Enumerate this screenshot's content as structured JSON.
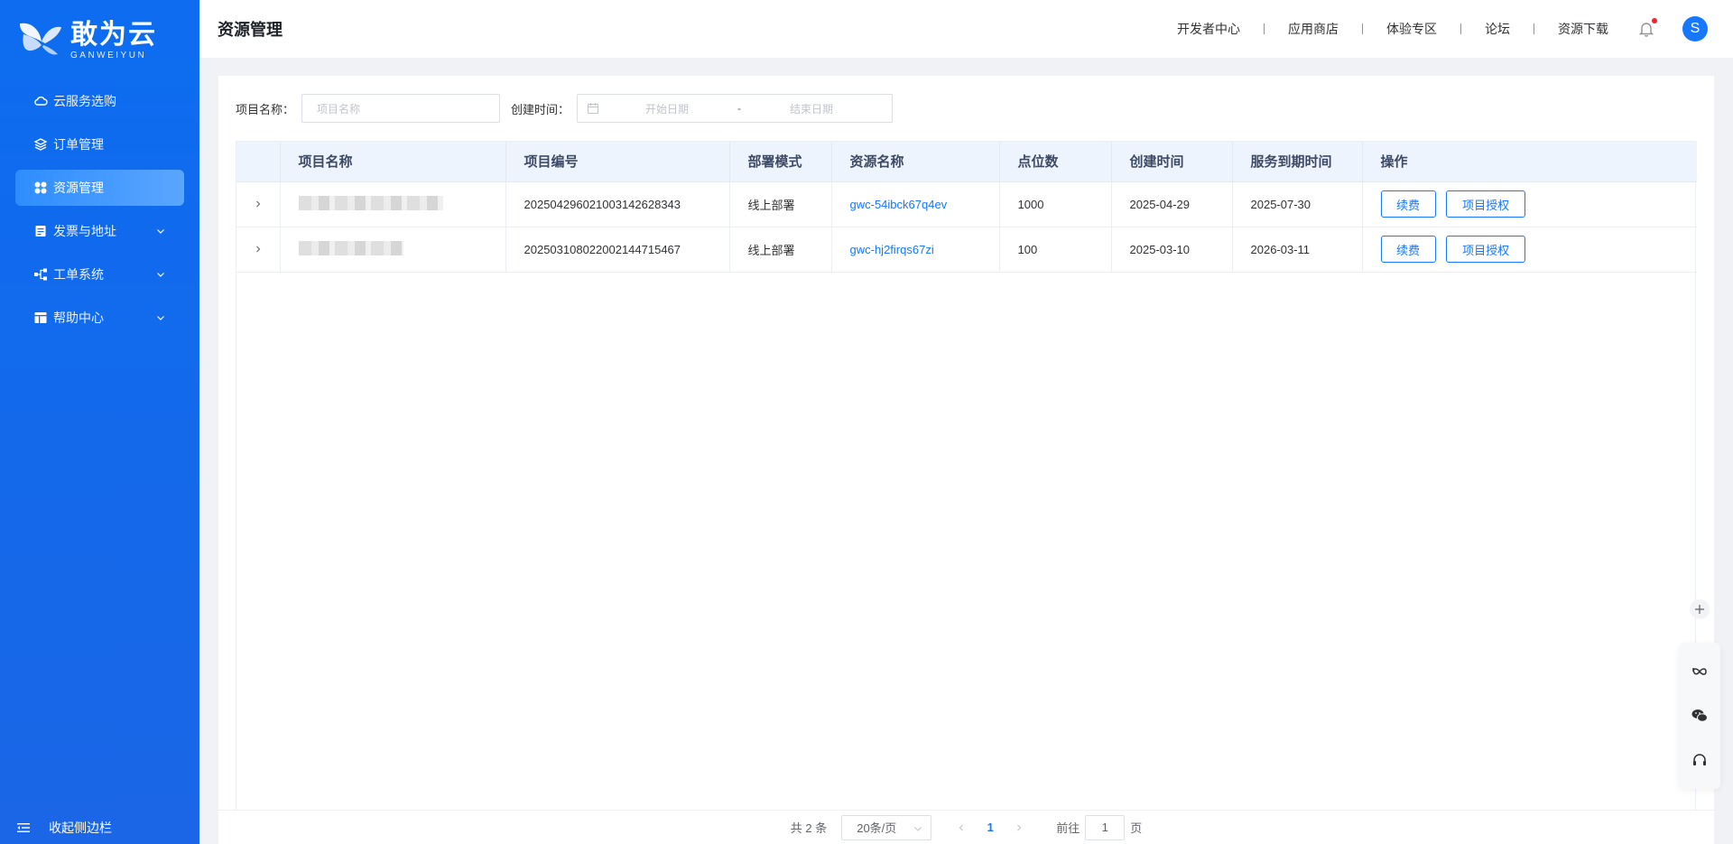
{
  "brand": {
    "name_cn": "敢为云",
    "name_en": "GANWEIYUN"
  },
  "sidebar": {
    "items": [
      {
        "label": "云服务选购",
        "icon": "cloud-icon",
        "active": false,
        "expandable": false
      },
      {
        "label": "订单管理",
        "icon": "layers-icon",
        "active": false,
        "expandable": false
      },
      {
        "label": "资源管理",
        "icon": "grid-icon",
        "active": true,
        "expandable": false
      },
      {
        "label": "发票与地址",
        "icon": "invoice-icon",
        "active": false,
        "expandable": true
      },
      {
        "label": "工单系统",
        "icon": "workflow-icon",
        "active": false,
        "expandable": true
      },
      {
        "label": "帮助中心",
        "icon": "help-icon",
        "active": false,
        "expandable": true
      }
    ],
    "collapse_label": "收起侧边栏"
  },
  "header": {
    "title": "资源管理",
    "links": [
      "开发者中心",
      "应用商店",
      "体验专区",
      "论坛",
      "资源下载"
    ],
    "avatar_letter": "S"
  },
  "filters": {
    "project_name_label": "项目名称：",
    "project_name_placeholder": "项目名称",
    "created_label": "创建时间：",
    "start_placeholder": "开始日期",
    "range_sep": "-",
    "end_placeholder": "结束日期"
  },
  "table": {
    "columns": [
      "",
      "项目名称",
      "项目编号",
      "部署模式",
      "资源名称",
      "点位数",
      "创建时间",
      "服务到期时间",
      "操作"
    ],
    "rows": [
      {
        "project_id": "20250429602100314262834​3",
        "deploy": "线上部署",
        "resource": "gwc-54ibck67q4ev",
        "points": "1000",
        "created": "2025-04-29",
        "expires": "2025-07-30"
      },
      {
        "project_id": "20250310802200214471546​7",
        "deploy": "线上部署",
        "resource": "gwc-hj2firqs67zi",
        "points": "100",
        "created": "2025-03-10",
        "expires": "2026-03-11"
      }
    ],
    "actions": {
      "renew": "续费",
      "authorize": "项目授权"
    }
  },
  "pagination": {
    "total": "共 2 条",
    "page_size": "20条/页",
    "current_page": "1",
    "goto_label": "前往",
    "goto_value": "1",
    "page_suffix": "页"
  },
  "colors": {
    "sidebar": "#0d6cf0",
    "accent": "#1677ff",
    "header_row": "#eef4fd"
  }
}
